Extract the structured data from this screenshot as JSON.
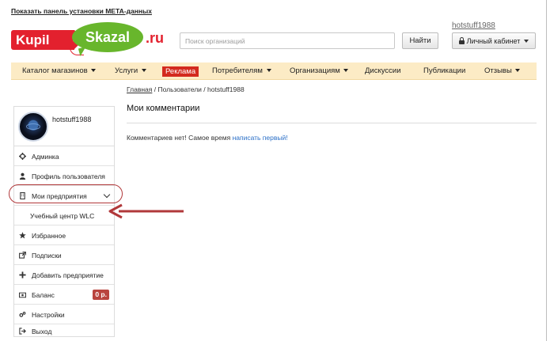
{
  "header": {
    "meta_link": "Показать панель установки МЕТА-данных",
    "logo": {
      "kupil": "Kupil",
      "skazal": "Skazal",
      "ru": ".ru"
    },
    "search_placeholder": "Поиск организаций",
    "search_button": "Найти",
    "username": "hotstuff1988",
    "cabinet_button": "Личный кабинет"
  },
  "nav": {
    "items": [
      {
        "label": "Каталог магазинов",
        "dropdown": true
      },
      {
        "label": "Услуги",
        "dropdown": true
      },
      {
        "label": "Реклама",
        "dropdown": false
      },
      {
        "label": "Потребителям",
        "dropdown": true
      },
      {
        "label": "Организациям",
        "dropdown": true
      },
      {
        "label": "Дискуссии",
        "dropdown": false
      },
      {
        "label": "Публикации",
        "dropdown": false
      },
      {
        "label": "Отзывы",
        "dropdown": true
      }
    ]
  },
  "breadcrumb": {
    "home": "Главная",
    "users": "Пользователи",
    "current": "hotstuff1988",
    "separator": " / "
  },
  "main": {
    "title": "Мои комментарии",
    "empty_text": "Комментариев нет! Самое время ",
    "empty_link": "написать первый!"
  },
  "sidebar": {
    "profile_name": "hotstuff1988",
    "items": [
      {
        "label": "Админка",
        "icon": "gear-icon"
      },
      {
        "label": "Профиль пользователя",
        "icon": "user-icon"
      },
      {
        "label": "Мои предприятия",
        "icon": "building-icon"
      },
      {
        "label": "Учебный центр WLC",
        "icon": ""
      },
      {
        "label": "Избранное",
        "icon": "star-icon"
      },
      {
        "label": "Подписки",
        "icon": "external-link-icon"
      },
      {
        "label": "Добавить предприятие",
        "icon": "plus-icon"
      },
      {
        "label": "Баланс",
        "icon": "money-icon"
      },
      {
        "label": "Настройки",
        "icon": "cogs-icon"
      },
      {
        "label": "Выход",
        "icon": "logout-icon"
      }
    ],
    "balance_badge": "0 р."
  },
  "colors": {
    "brand_red": "#e3212e",
    "brand_green": "#68b62c",
    "nav_bg": "#fcebc5",
    "link": "#2a6fc7",
    "badge": "#b9443e",
    "annotation": "#b1383a"
  }
}
